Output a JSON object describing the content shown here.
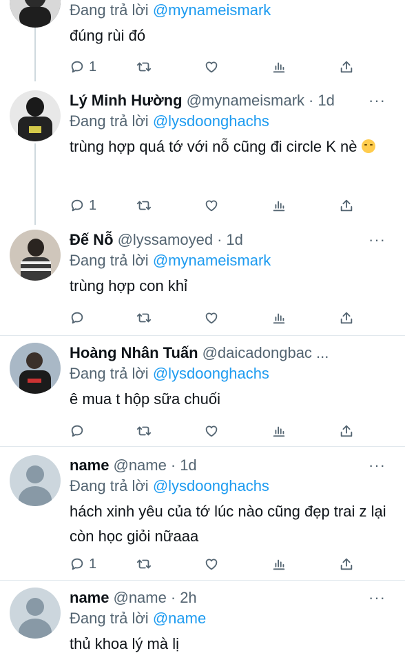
{
  "reply_label": "Đang trả lời",
  "more_label": "···",
  "tweets": [
    {
      "name": "",
      "handle": "",
      "time": "",
      "reply_to": "@mynameismark",
      "text": "đúng rùi đó",
      "reply_count": "1"
    },
    {
      "name": "Lý Minh Hường",
      "handle": "@mynameismark",
      "time": "1d",
      "reply_to": "@lysdoonghachs",
      "text": "trùng hợp quá tớ với nỗ cũng đi circle K nè",
      "reply_count": "1"
    },
    {
      "name": "Đế Nỗ",
      "handle": "@lyssamoyed",
      "time": "1d",
      "reply_to": "@mynameismark",
      "text": "trùng hợp con khỉ",
      "reply_count": ""
    },
    {
      "name": "Hoàng Nhân Tuấn",
      "handle": "@daicadongbac ...",
      "time": "",
      "reply_to": "@lysdoonghachs",
      "text": "ê mua t hộp sữa chuối",
      "reply_count": ""
    },
    {
      "name": "name",
      "handle": "@name",
      "time": "1d",
      "reply_to": "@lysdoonghachs",
      "text": "hách xinh yêu của tớ lúc nào cũng đẹp trai z lại còn học giỏi nữaaa",
      "reply_count": "1"
    },
    {
      "name": "name",
      "handle": "@name",
      "time": "2h",
      "reply_to": "@name",
      "text": "thủ khoa lý mà lị",
      "reply_count": ""
    }
  ],
  "icons": {
    "reply": "reply-icon",
    "retweet": "retweet-icon",
    "like": "heart-icon",
    "stats": "stats-icon",
    "share": "share-icon"
  },
  "colors": {
    "mention": "#1d9bf0",
    "secondary_text": "#536471",
    "thread_line": "#cfd9de"
  }
}
